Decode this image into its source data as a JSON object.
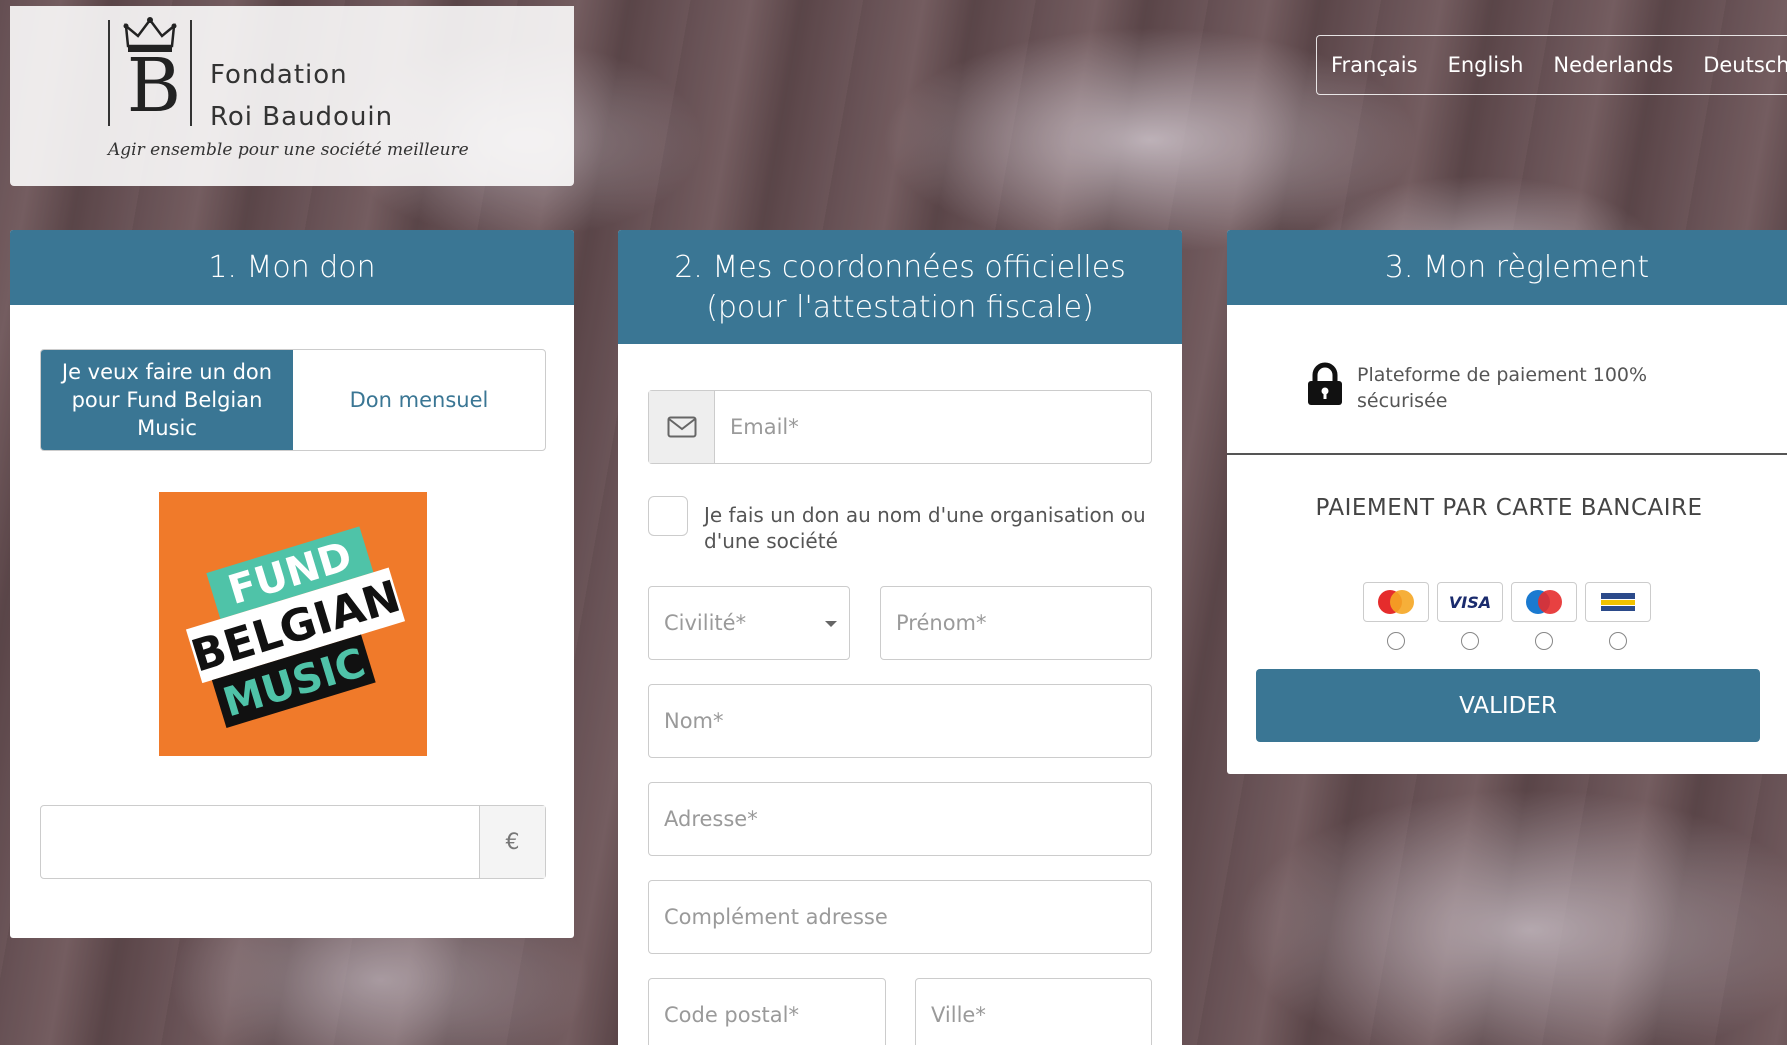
{
  "colors": {
    "primary": "#3a7694",
    "fund_orange": "#f07a2a",
    "fund_teal": "#4fc3a8"
  },
  "logo": {
    "name_line1": "Fondation",
    "name_line2": "Roi Baudouin",
    "letter": "B",
    "tagline": "Agir ensemble pour une société meilleure"
  },
  "languages": [
    "Français",
    "English",
    "Nederlands",
    "Deutsch"
  ],
  "step1": {
    "title": "1. Mon don",
    "option_one_time": "Je veux faire un don pour Fund Belgian Music",
    "option_monthly": "Don mensuel",
    "fund_logo": {
      "line1": "FUND",
      "line2": "BELGIAN",
      "line3": "MUSIC"
    },
    "amount_value": "",
    "currency": "€"
  },
  "step2": {
    "title_line1": "2. Mes coordonnées officielles",
    "title_line2": "(pour l'attestation fiscale)",
    "email_placeholder": "Email*",
    "org_label": "Je fais un don au nom d'une organisation ou d'une société",
    "civilite_placeholder": "Civilité*",
    "prenom_placeholder": "Prénom*",
    "nom_placeholder": "Nom*",
    "adresse_placeholder": "Adresse*",
    "complement_placeholder": "Complément adresse",
    "code_postal_placeholder": "Code postal*",
    "ville_placeholder": "Ville*"
  },
  "step3": {
    "title": "3. Mon règlement",
    "secure_text": "Plateforme de paiement 100% sécurisée",
    "card_section_title": "PAIEMENT PAR CARTE BANCAIRE",
    "cards": [
      "MasterCard",
      "VISA",
      "Maestro",
      "Bancontact Mister Cash"
    ],
    "submit_label": "VALIDER"
  }
}
